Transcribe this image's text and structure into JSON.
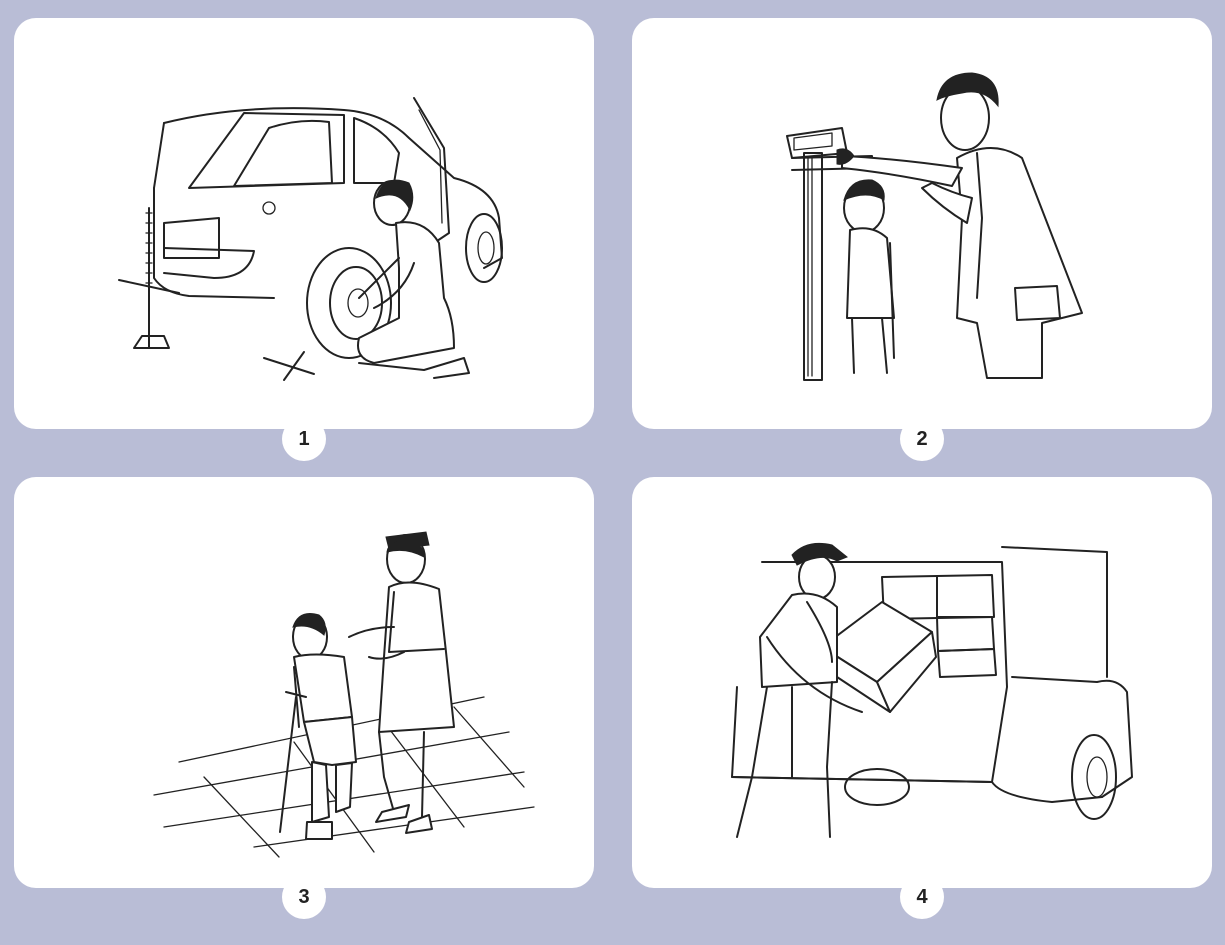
{
  "panels": [
    {
      "number": "1",
      "scene": "changing-tire"
    },
    {
      "number": "2",
      "scene": "measuring-height"
    },
    {
      "number": "3",
      "scene": "helping-child-with-crutch"
    },
    {
      "number": "4",
      "scene": "loading-box-onto-truck"
    }
  ]
}
